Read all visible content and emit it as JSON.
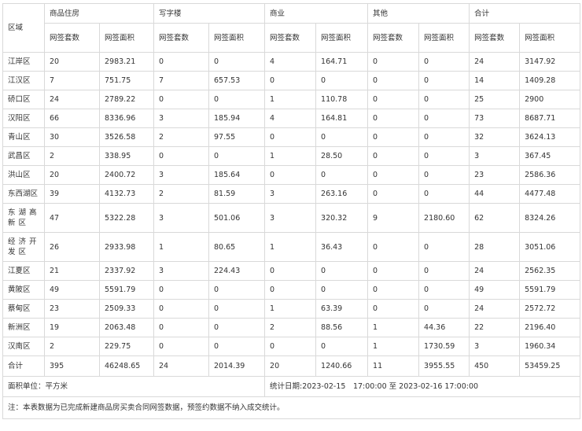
{
  "table": {
    "region_header": "区域",
    "groups": [
      "商品住房",
      "写字楼",
      "商业",
      "其他",
      "合计"
    ],
    "sub": [
      "网签套数",
      "网签面积"
    ],
    "rows": [
      [
        "江岸区",
        "20",
        "2983.21",
        "0",
        "0",
        "4",
        "164.71",
        "0",
        "0",
        "24",
        "3147.92"
      ],
      [
        "江汉区",
        "7",
        "751.75",
        "7",
        "657.53",
        "0",
        "0",
        "0",
        "0",
        "14",
        "1409.28"
      ],
      [
        "硚口区",
        "24",
        "2789.22",
        "0",
        "0",
        "1",
        "110.78",
        "0",
        "0",
        "25",
        "2900"
      ],
      [
        "汉阳区",
        "66",
        "8336.96",
        "3",
        "185.94",
        "4",
        "164.81",
        "0",
        "0",
        "73",
        "8687.71"
      ],
      [
        "青山区",
        "30",
        "3526.58",
        "2",
        "97.55",
        "0",
        "0",
        "0",
        "0",
        "32",
        "3624.13"
      ],
      [
        "武昌区",
        "2",
        "338.95",
        "0",
        "0",
        "1",
        "28.50",
        "0",
        "0",
        "3",
        "367.45"
      ],
      [
        "洪山区",
        "20",
        "2400.72",
        "3",
        "185.64",
        "0",
        "0",
        "0",
        "0",
        "23",
        "2586.36"
      ],
      [
        "东西湖区",
        "39",
        "4132.73",
        "2",
        "81.59",
        "3",
        "263.16",
        "0",
        "0",
        "44",
        "4477.48"
      ],
      [
        "东湖高新区",
        "47",
        "5322.28",
        "3",
        "501.06",
        "3",
        "320.32",
        "9",
        "2180.60",
        "62",
        "8324.26"
      ],
      [
        "经济开发区",
        "26",
        "2933.98",
        "1",
        "80.65",
        "1",
        "36.43",
        "0",
        "0",
        "28",
        "3051.06"
      ],
      [
        "江夏区",
        "21",
        "2337.92",
        "3",
        "224.43",
        "0",
        "0",
        "0",
        "0",
        "24",
        "2562.35"
      ],
      [
        "黄陂区",
        "49",
        "5591.79",
        "0",
        "0",
        "0",
        "0",
        "0",
        "0",
        "49",
        "5591.79"
      ],
      [
        "蔡甸区",
        "23",
        "2509.33",
        "0",
        "0",
        "1",
        "63.39",
        "0",
        "0",
        "24",
        "2572.72"
      ],
      [
        "新洲区",
        "19",
        "2063.48",
        "0",
        "0",
        "2",
        "88.56",
        "1",
        "44.36",
        "22",
        "2196.40"
      ],
      [
        "汉南区",
        "2",
        "229.75",
        "0",
        "0",
        "0",
        "0",
        "1",
        "1730.59",
        "3",
        "1960.34"
      ],
      [
        "合计",
        "395",
        "46248.65",
        "24",
        "2014.39",
        "20",
        "1240.66",
        "11",
        "3955.55",
        "450",
        "53459.25"
      ]
    ],
    "unit_label": "面积单位：平方米",
    "stats_date": "统计日期:2023-02-15　17:00:00 至 2023-02-16 17:00:00",
    "note": "注：本表数据为已完成新建商品房买卖合同网签数据，预签约数据不纳入成交统计。"
  }
}
